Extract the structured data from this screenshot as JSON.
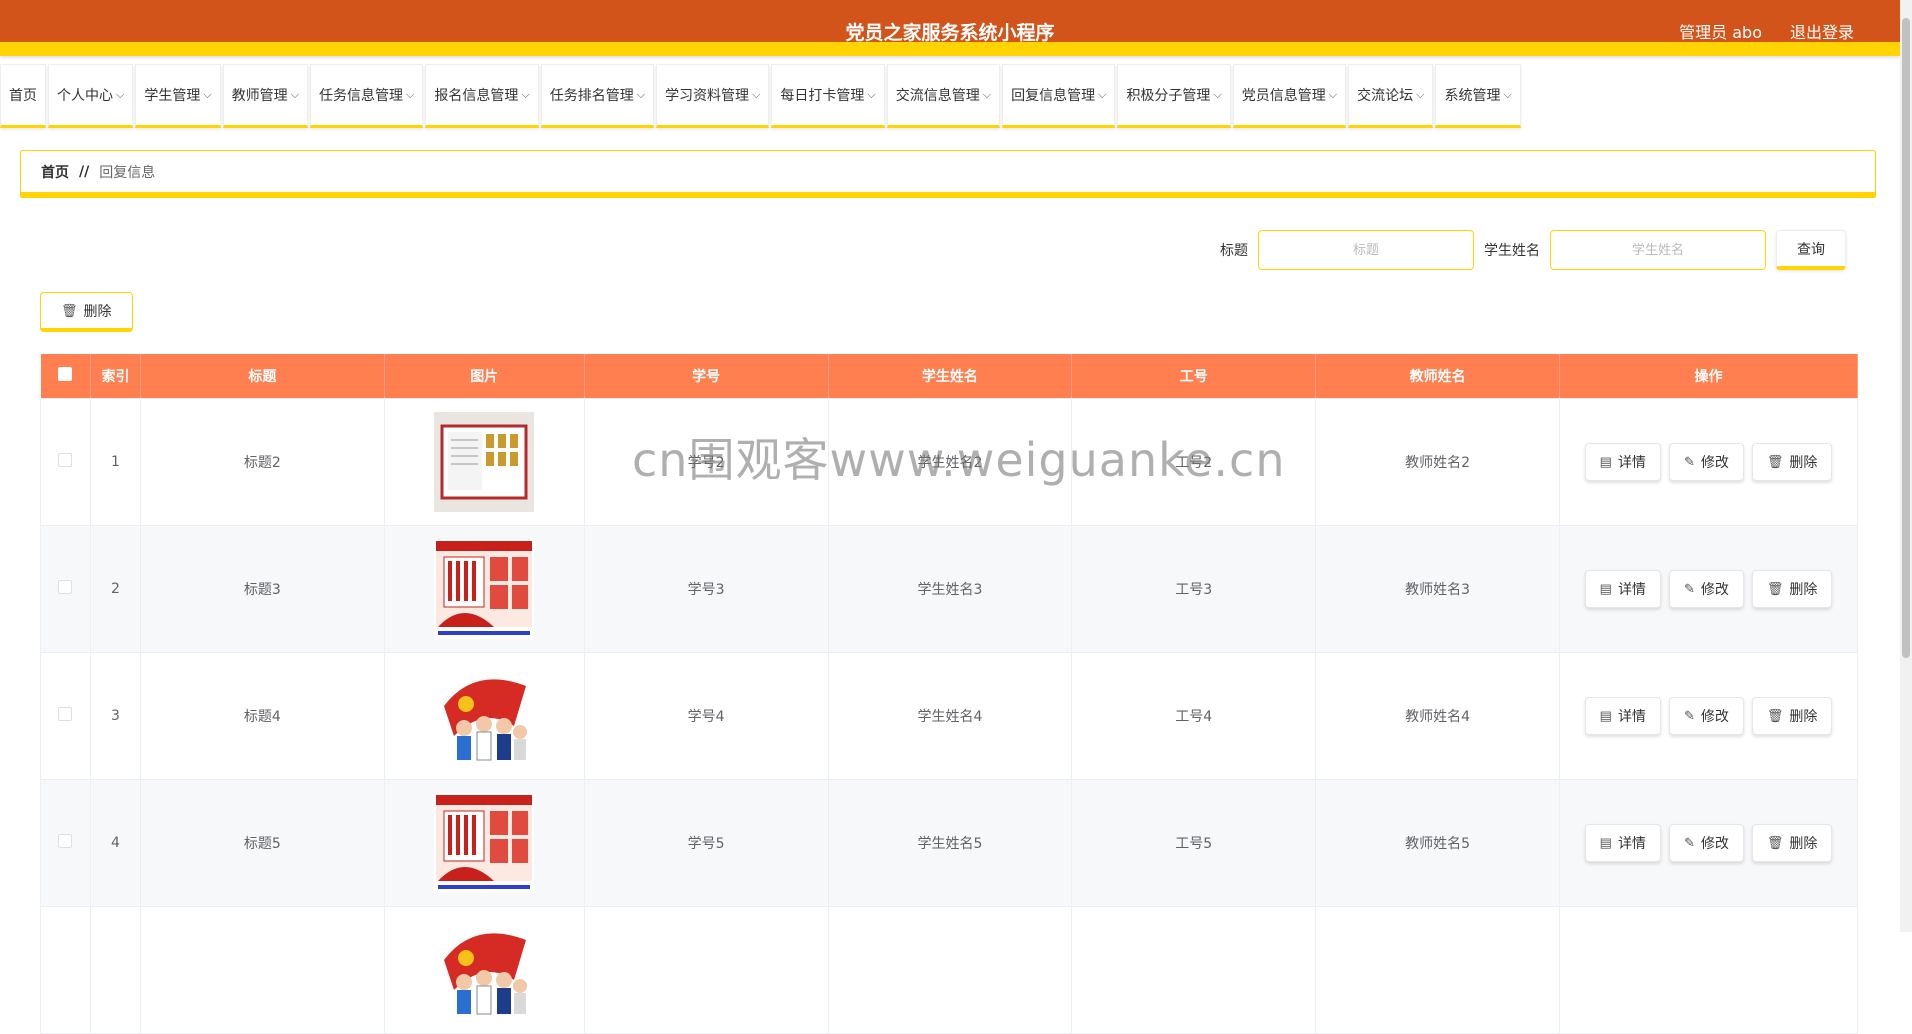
{
  "header": {
    "title": "党员之家服务系统小程序",
    "user": "管理员 abo",
    "logout": "退出登录",
    "bg_color": "#d2541a",
    "accent_color": "#ffd400"
  },
  "nav": {
    "items": [
      {
        "label": "首页",
        "has_dropdown": false
      },
      {
        "label": "个人中心",
        "has_dropdown": true
      },
      {
        "label": "学生管理",
        "has_dropdown": true
      },
      {
        "label": "教师管理",
        "has_dropdown": true
      },
      {
        "label": "任务信息管理",
        "has_dropdown": true
      },
      {
        "label": "报名信息管理",
        "has_dropdown": true
      },
      {
        "label": "任务排名管理",
        "has_dropdown": true
      },
      {
        "label": "学习资料管理",
        "has_dropdown": true
      },
      {
        "label": "每日打卡管理",
        "has_dropdown": true
      },
      {
        "label": "交流信息管理",
        "has_dropdown": true
      },
      {
        "label": "回复信息管理",
        "has_dropdown": true
      },
      {
        "label": "积极分子管理",
        "has_dropdown": true
      },
      {
        "label": "党员信息管理",
        "has_dropdown": true
      },
      {
        "label": "交流论坛",
        "has_dropdown": true
      },
      {
        "label": "系统管理",
        "has_dropdown": true
      }
    ]
  },
  "breadcrumb": {
    "home": "首页",
    "separator": "//",
    "current": "回复信息"
  },
  "search": {
    "title_label": "标题",
    "title_placeholder": "标题",
    "student_label": "学生姓名",
    "student_placeholder": "学生姓名",
    "query_button": "查询"
  },
  "actions": {
    "delete_button": "删除"
  },
  "table": {
    "headers": [
      "索引",
      "标题",
      "图片",
      "学号",
      "学生姓名",
      "工号",
      "教师姓名",
      "操作"
    ],
    "header_color": "#ff7f50",
    "rows": [
      {
        "index": "1",
        "title": "标题2",
        "image": "wall-board",
        "student_no": "学号2",
        "student_name": "学生姓名2",
        "work_no": "工号2",
        "teacher_name": "教师姓名2"
      },
      {
        "index": "2",
        "title": "标题3",
        "image": "party-poster",
        "student_no": "学号3",
        "student_name": "学生姓名3",
        "work_no": "工号3",
        "teacher_name": "教师姓名3"
      },
      {
        "index": "3",
        "title": "标题4",
        "image": "party-cartoon",
        "student_no": "学号4",
        "student_name": "学生姓名4",
        "work_no": "工号4",
        "teacher_name": "教师姓名4"
      },
      {
        "index": "4",
        "title": "标题5",
        "image": "party-poster",
        "student_no": "学号5",
        "student_name": "学生姓名5",
        "work_no": "工号5",
        "teacher_name": "教师姓名5"
      }
    ],
    "row_buttons": {
      "detail": "详情",
      "edit": "修改",
      "delete": "删除"
    }
  },
  "watermark": "cn围观客www.weiguanke.cn"
}
